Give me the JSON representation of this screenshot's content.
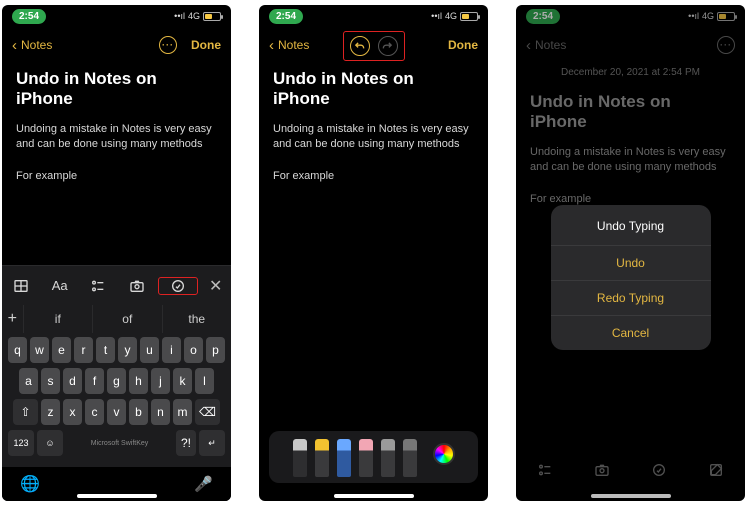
{
  "status": {
    "time": "2:54",
    "network": "4G"
  },
  "nav": {
    "back_label": "Notes",
    "done_label": "Done"
  },
  "note": {
    "title": "Undo in Notes on iPhone",
    "paragraph": "Undoing a mistake in Notes is very easy and can be done using many methods",
    "example": "For example"
  },
  "panel3_date": "December 20, 2021 at 2:54 PM",
  "keyboard": {
    "suggestions_plus": "+",
    "suggestions": [
      "if",
      "of",
      "the"
    ],
    "row1": [
      "q",
      "w",
      "e",
      "r",
      "t",
      "y",
      "u",
      "i",
      "o",
      "p"
    ],
    "row2": [
      "a",
      "s",
      "d",
      "f",
      "g",
      "h",
      "j",
      "k",
      "l"
    ],
    "row3": [
      "z",
      "x",
      "c",
      "v",
      "b",
      "n",
      "m"
    ],
    "numkey": "123",
    "brand": "Microsoft SwiftKey",
    "punct": "?!"
  },
  "action_sheet": {
    "title": "Undo Typing",
    "undo": "Undo",
    "redo": "Redo Typing",
    "cancel": "Cancel"
  },
  "tools": {
    "pens": [
      {
        "name": "pen-black",
        "color": "#2e2e30",
        "tip": "#c8c8c8"
      },
      {
        "name": "pen-yellow",
        "color": "#3a3a3c",
        "tip": "#f2c230"
      },
      {
        "name": "marker-blue",
        "color": "#2f5aa0",
        "tip": "#6aa8ff"
      },
      {
        "name": "eraser-pink",
        "color": "#3a3a3c",
        "tip": "#f2a6b4"
      },
      {
        "name": "pencil-grey",
        "color": "#3a3a3c",
        "tip": "#9a9a9a"
      },
      {
        "name": "ruler",
        "color": "#3a3a3c",
        "tip": "#777"
      }
    ]
  }
}
